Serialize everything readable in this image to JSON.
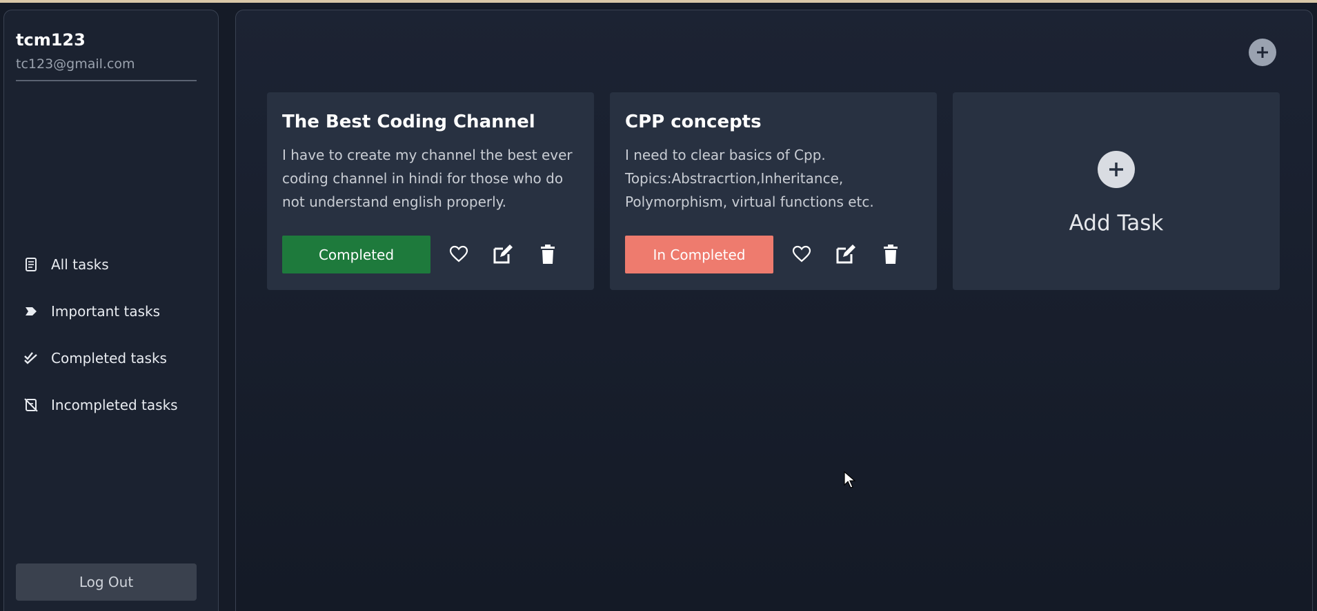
{
  "user": {
    "name": "tcm123",
    "email": "tc123@gmail.com"
  },
  "sidebar": {
    "items": [
      {
        "label": "All tasks",
        "icon": "notes-icon"
      },
      {
        "label": "Important tasks",
        "icon": "tag-icon"
      },
      {
        "label": "Completed tasks",
        "icon": "double-check-icon"
      },
      {
        "label": "Incompleted tasks",
        "icon": "cross-note-icon"
      }
    ],
    "logout_label": "Log Out"
  },
  "cards": [
    {
      "title": "The Best Coding Channel",
      "description": "I have to create my channel the best ever coding channel in hindi for those who do not understand english properly.",
      "status_label": "Completed",
      "status_color": "#1e7a3c"
    },
    {
      "title": "CPP concepts",
      "description": "I need to clear basics of Cpp. Topics:Abstracrtion,Inheritance, Polymorphism, virtual functions etc.",
      "status_label": "In Completed",
      "status_color": "#ee7b6e"
    }
  ],
  "add_card": {
    "label": "Add Task"
  },
  "colors": {
    "background": "#151b27",
    "card": "#283141",
    "sidebar": "#1b2230",
    "completed": "#1e7a3c",
    "incompleted": "#ee7b6e"
  }
}
